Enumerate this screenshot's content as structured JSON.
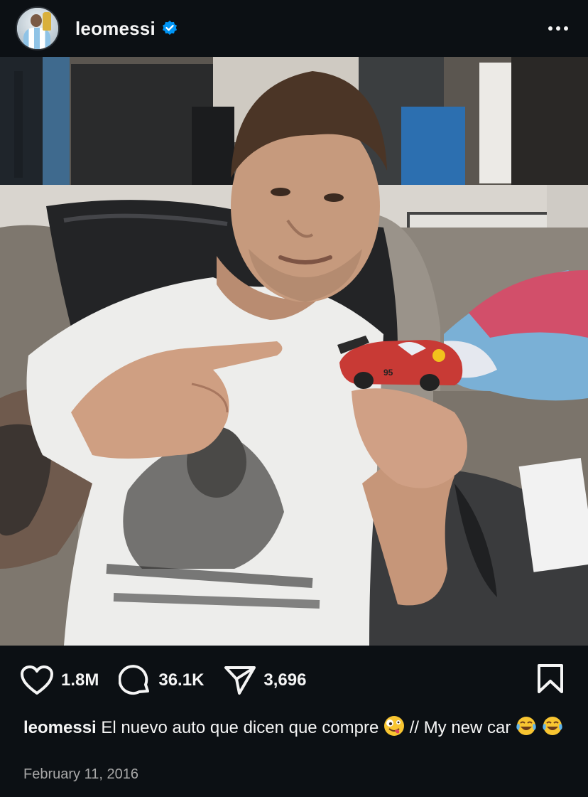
{
  "header": {
    "username": "leomessi",
    "verified_icon": "verified-badge-icon",
    "more_icon": "more-options-icon"
  },
  "post": {
    "image_alt_icon": "post-photo",
    "likes": "1.8M",
    "comments": "36.1K",
    "shares": "3,696"
  },
  "caption": {
    "username": "leomessi",
    "text_part1": "El nuevo auto que dicen que compre ",
    "text_part2": "// My new car",
    "emojis": [
      "zany-face-emoji",
      "tears-of-joy-emoji",
      "tears-of-joy-emoji"
    ]
  },
  "date": "February 11, 2016",
  "colors": {
    "background": "#0c1014",
    "text": "#f5f5f5",
    "muted": "#a8a8a8",
    "verified": "#0095f6"
  }
}
